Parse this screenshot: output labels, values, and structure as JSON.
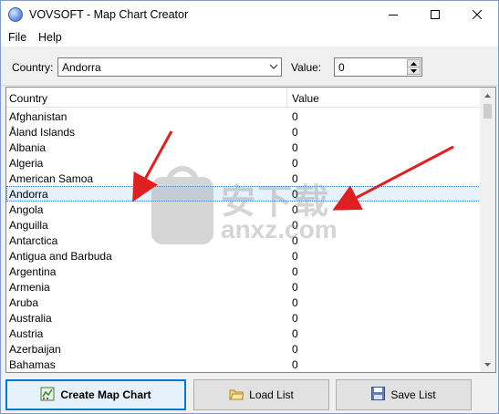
{
  "window": {
    "title": "VOVSOFT - Map Chart Creator"
  },
  "menu": {
    "file": "File",
    "help": "Help"
  },
  "controls": {
    "country_label": "Country:",
    "country_value": "Andorra",
    "value_label": "Value:",
    "value_value": "0"
  },
  "list": {
    "headers": {
      "country": "Country",
      "value": "Value"
    },
    "rows": [
      {
        "country": "Afghanistan",
        "value": "0"
      },
      {
        "country": "Åland Islands",
        "value": "0"
      },
      {
        "country": "Albania",
        "value": "0"
      },
      {
        "country": "Algeria",
        "value": "0"
      },
      {
        "country": "American Samoa",
        "value": "0"
      },
      {
        "country": "Andorra",
        "value": "0"
      },
      {
        "country": "Angola",
        "value": "0"
      },
      {
        "country": "Anguilla",
        "value": "0"
      },
      {
        "country": "Antarctica",
        "value": "0"
      },
      {
        "country": "Antigua and Barbuda",
        "value": "0"
      },
      {
        "country": "Argentina",
        "value": "0"
      },
      {
        "country": "Armenia",
        "value": "0"
      },
      {
        "country": "Aruba",
        "value": "0"
      },
      {
        "country": "Australia",
        "value": "0"
      },
      {
        "country": "Austria",
        "value": "0"
      },
      {
        "country": "Azerbaijan",
        "value": "0"
      },
      {
        "country": "Bahamas",
        "value": "0"
      }
    ],
    "selected_country": "Andorra"
  },
  "buttons": {
    "create": "Create Map Chart",
    "load": "Load List",
    "save": "Save List"
  },
  "watermark": {
    "cn": "安下载",
    "en": "anxz.com"
  },
  "colors": {
    "selection": "#e5f1fb",
    "focus_border": "#0078d7",
    "annotation_arrow": "#e02020"
  }
}
